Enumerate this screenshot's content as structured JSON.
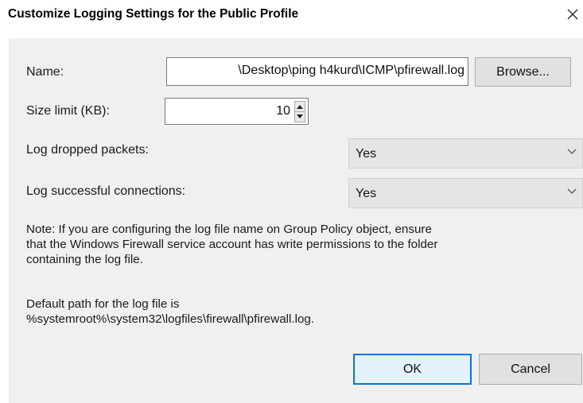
{
  "dialog": {
    "title": "Customize Logging Settings for the Public Profile",
    "close_icon": "close-icon"
  },
  "name": {
    "label": "Name:",
    "value": "\\Desktop\\ping h4kurd\\ICMP\\pfirewall.log",
    "browse_label": "Browse..."
  },
  "size_limit": {
    "label": "Size limit (KB):",
    "value": "10"
  },
  "log_dropped": {
    "label": "Log dropped packets:",
    "value": "Yes"
  },
  "log_successful": {
    "label": "Log successful connections:",
    "value": "Yes"
  },
  "note": {
    "line1": "Note: If you are configuring the log file name on Group Policy object, ensure",
    "line2": "that the Windows Firewall service account has write permissions to the folder",
    "line3": "containing the log file."
  },
  "default_path": {
    "line1": "Default path for the log file is",
    "line2": "%systemroot%\\system32\\logfiles\\firewall\\pfirewall.log."
  },
  "buttons": {
    "ok": "OK",
    "cancel": "Cancel"
  },
  "colors": {
    "accent": "#0078d7",
    "panel": "#f0f0f0"
  }
}
